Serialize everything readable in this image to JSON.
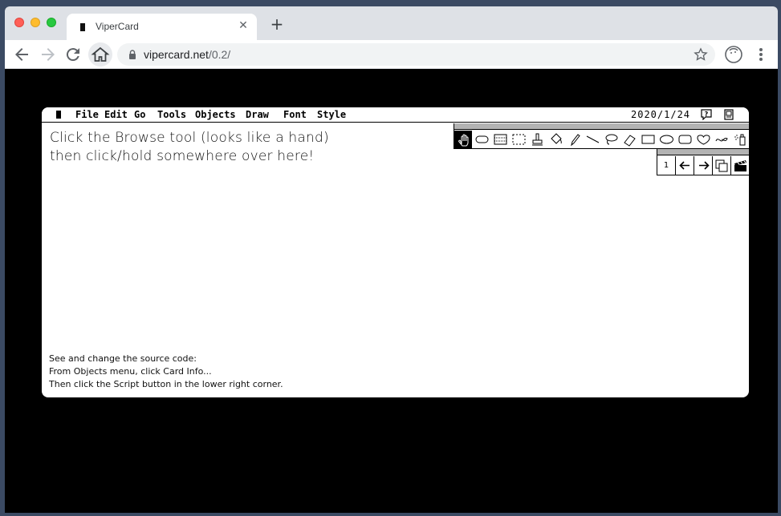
{
  "browser": {
    "tab_title": "ViperCard",
    "url_host": "vipercard.net",
    "url_path": "/0.2/"
  },
  "vipercard": {
    "menu": [
      "File",
      "Edit",
      "Go",
      "Tools",
      "Objects",
      "Draw",
      "Font",
      "Style"
    ],
    "date": "2020/1/24",
    "card_number": "1",
    "main_text": [
      "Click the Browse tool (looks like a hand)",
      "then click/hold somewhere over here!"
    ],
    "hint_text": [
      "See and change the source code:",
      "From Objects menu, click Card Info...",
      "Then click the Script button in the lower right corner."
    ],
    "tools": [
      "browse-tool-hand-icon",
      "button-tool-icon",
      "field-tool-icon",
      "select-tool-icon",
      "stamp-tool-icon",
      "bucket-tool-icon",
      "pencil-tool-icon",
      "line-tool-icon",
      "lasso-tool-icon",
      "eraser-tool-icon",
      "rectangle-tool-icon",
      "oval-tool-icon",
      "round-rect-tool-icon",
      "shape-tool-icon",
      "curve-tool-icon",
      "spray-tool-icon"
    ],
    "selected_tool": "browse-tool-hand-icon"
  }
}
